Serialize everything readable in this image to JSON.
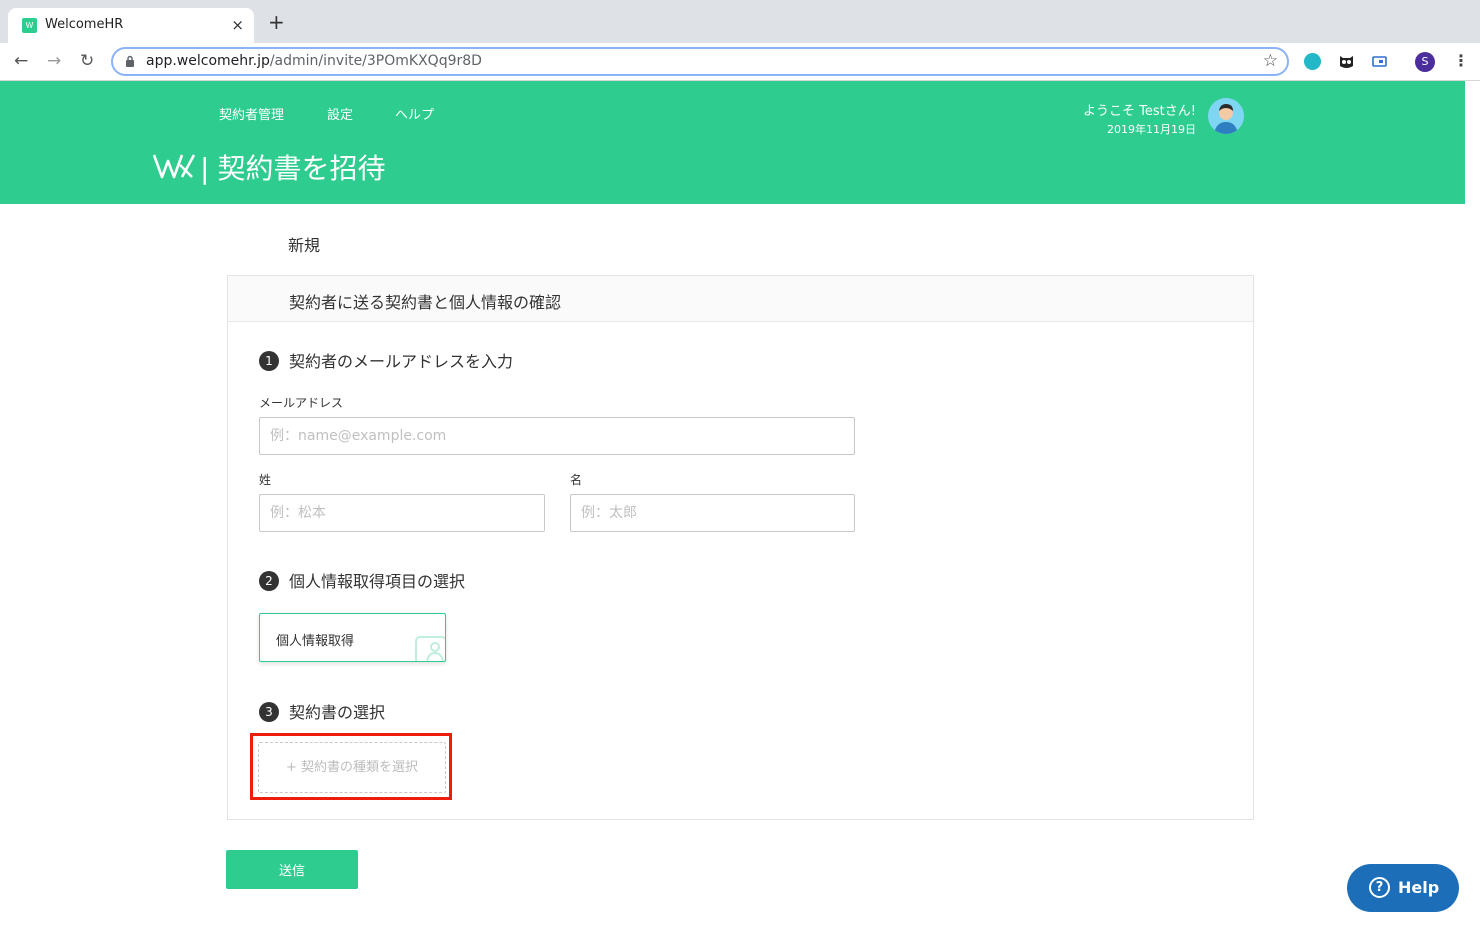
{
  "browser": {
    "tab_title": "WelcomeHR",
    "tab_close": "×",
    "new_tab": "+",
    "url_host": "app.welcomehr.jp",
    "url_path": "/admin/invite/3POmKXQq9r8D",
    "profile_initial": "S"
  },
  "header": {
    "nav": [
      "契約者管理",
      "設定",
      "ヘルプ"
    ],
    "welcome": "ようこそ Testさん!",
    "date": "2019年11月19日",
    "title_separator": "|",
    "page_title": "契約書を招待",
    "brand_color": "#2ecc8f"
  },
  "main": {
    "sub_title": "新規",
    "card_title": "契約者に送る契約書と個人情報の確認",
    "steps": [
      {
        "number": "1",
        "label": "契約者のメールアドレスを入力"
      },
      {
        "number": "2",
        "label": "個人情報取得項目の選択"
      },
      {
        "number": "3",
        "label": "契約書の選択"
      }
    ],
    "email": {
      "label": "メールアドレス",
      "placeholder": "例：name@example.com"
    },
    "last_name": {
      "label": "姓",
      "placeholder": "例：松本"
    },
    "first_name": {
      "label": "名",
      "placeholder": "例：太郎"
    },
    "personal_info_tile": "個人情報取得",
    "add_contract": "+ 契約書の種類を選択",
    "submit": "送信",
    "highlight_color": "#ee1c0a"
  },
  "help": {
    "icon": "?",
    "label": "Help"
  }
}
